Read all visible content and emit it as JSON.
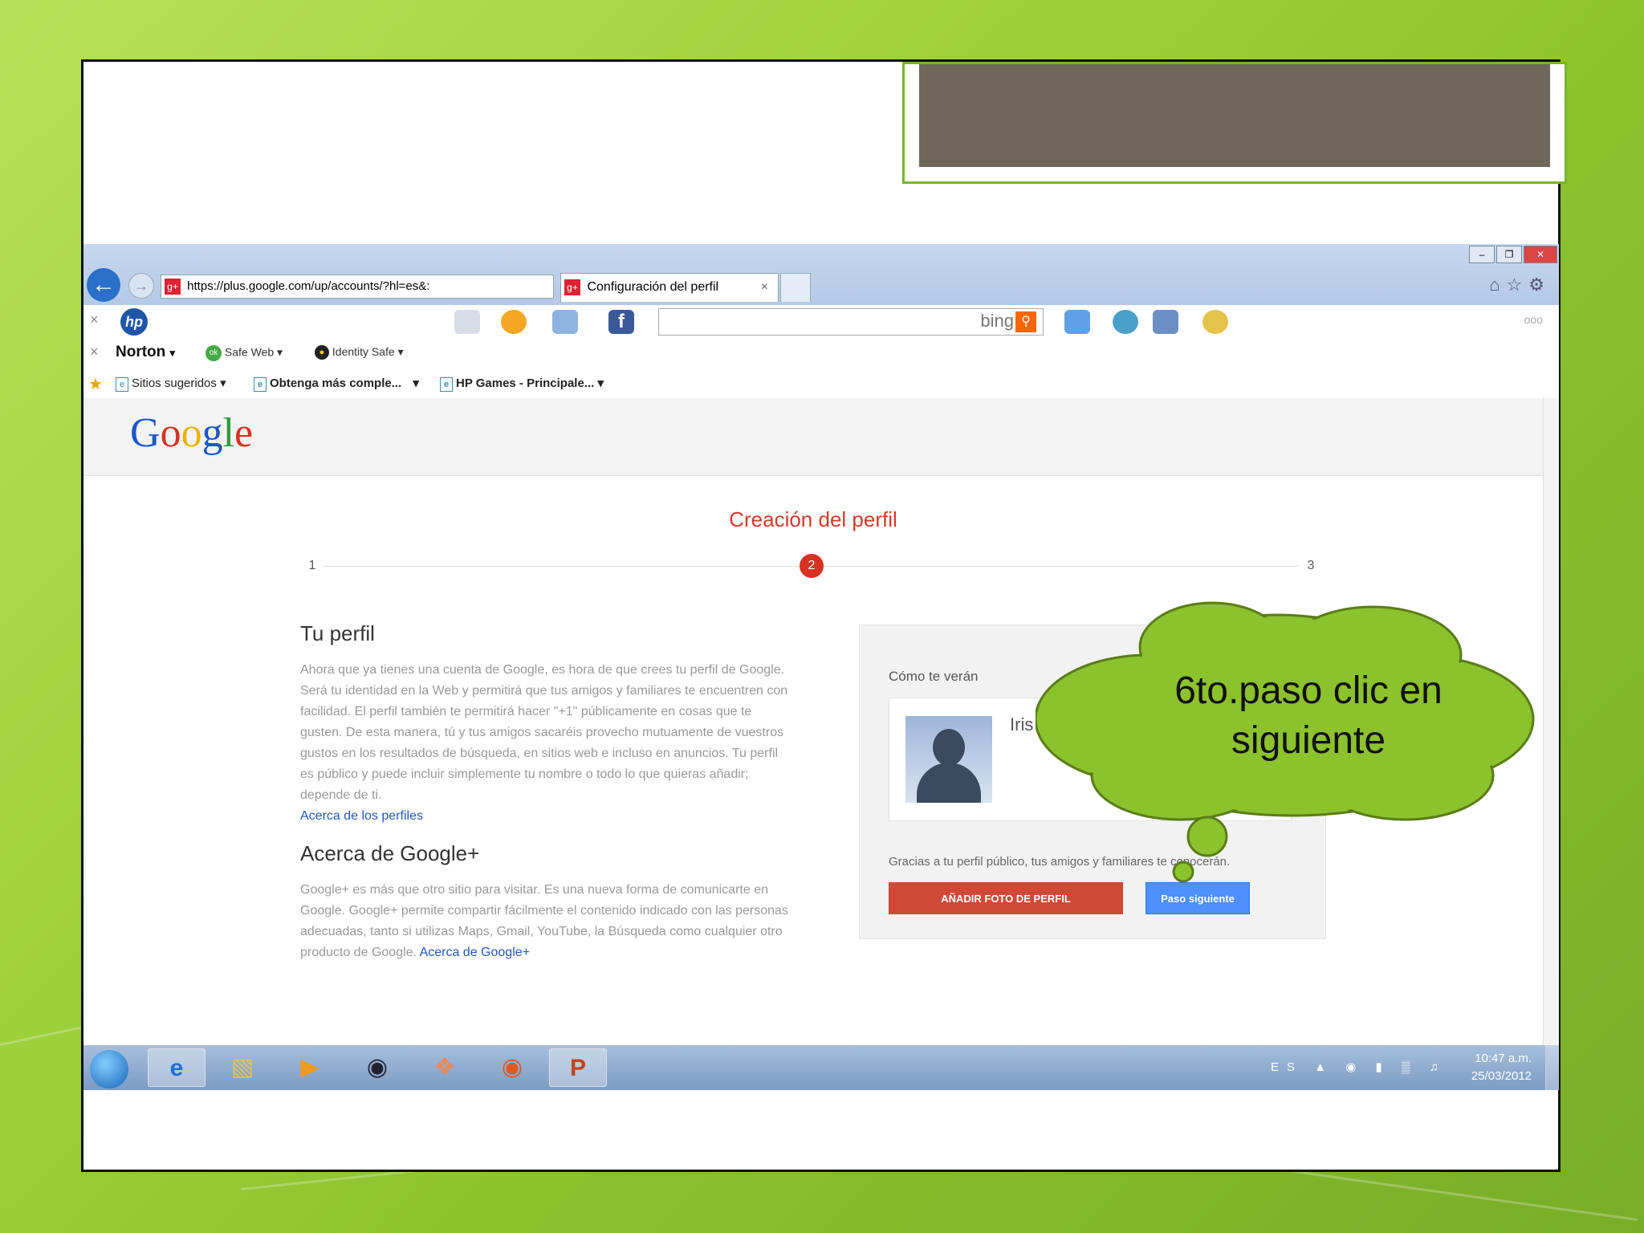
{
  "browser": {
    "url": "https://plus.google.com/up/accounts/?hl=es&:",
    "tab_title": "Configuración del perfil",
    "tab_close": "×",
    "close_x": "×"
  },
  "toolbars": {
    "hp_logo": "hp",
    "search_engine": "bing",
    "norton": {
      "brand": "Norton",
      "safe_web": "Safe Web",
      "identity_safe": "Identity Safe",
      "ok": "ok"
    },
    "favorites": [
      {
        "label": "Sitios sugeridos"
      },
      {
        "label": "Obtenga más comple..."
      },
      {
        "label": "HP Games - Principale..."
      }
    ],
    "dropdown": "▾",
    "more": "ooo"
  },
  "page": {
    "logo": {
      "g1": "G",
      "o1": "o",
      "o2": "o",
      "g2": "g",
      "l": "l",
      "e": "e"
    },
    "title": "Creación del perfil",
    "steps": [
      "1",
      "2",
      "3"
    ],
    "active_step": 2,
    "profile_section": {
      "heading": "Tu perfil",
      "body": "Ahora que ya tienes una cuenta de Google, es hora de que crees tu perfil de Google. Será tu identidad en la Web y permitirá que tus amigos y familiares te encuentren con facilidad. El perfil también te permitirá hacer \"+1\" públicamente en cosas que te gusten. De esta manera, tú y tus amigos sacaréis provecho mutuamente de vuestros gustos en los resultados de búsqueda, en sitios web e incluso en anuncios. Tu perfil es público y puede incluir simplemente tu nombre o todo lo que quieras añadir; depende de ti.",
      "link": "Acerca de los perfiles"
    },
    "gplus_section": {
      "heading": "Acerca de Google+",
      "body": "Google+ es más que otro sitio para visitar. Es una nueva forma de comunicarte en Google. Google+ permite compartir fácilmente el contenido indicado con las personas adecuadas, tanto si utilizas Maps, Gmail, YouTube, la Búsqueda como cualquier otro producto de Google.",
      "link": "Acerca de Google+"
    },
    "card": {
      "label": "Cómo te verán",
      "name": "Iris M",
      "note": "Gracias a tu perfil público, tus amigos y familiares te conocerán.",
      "add_photo_button": "AÑADIR FOTO DE PERFIL",
      "next_button": "Paso siguiente"
    }
  },
  "taskbar": {
    "language": "ES",
    "time": "10:47 a.m.",
    "date": "25/03/2012"
  },
  "callout": {
    "line1": "6to.paso clic en",
    "line2": "siguiente",
    "fill_color": "#8cc22e"
  }
}
